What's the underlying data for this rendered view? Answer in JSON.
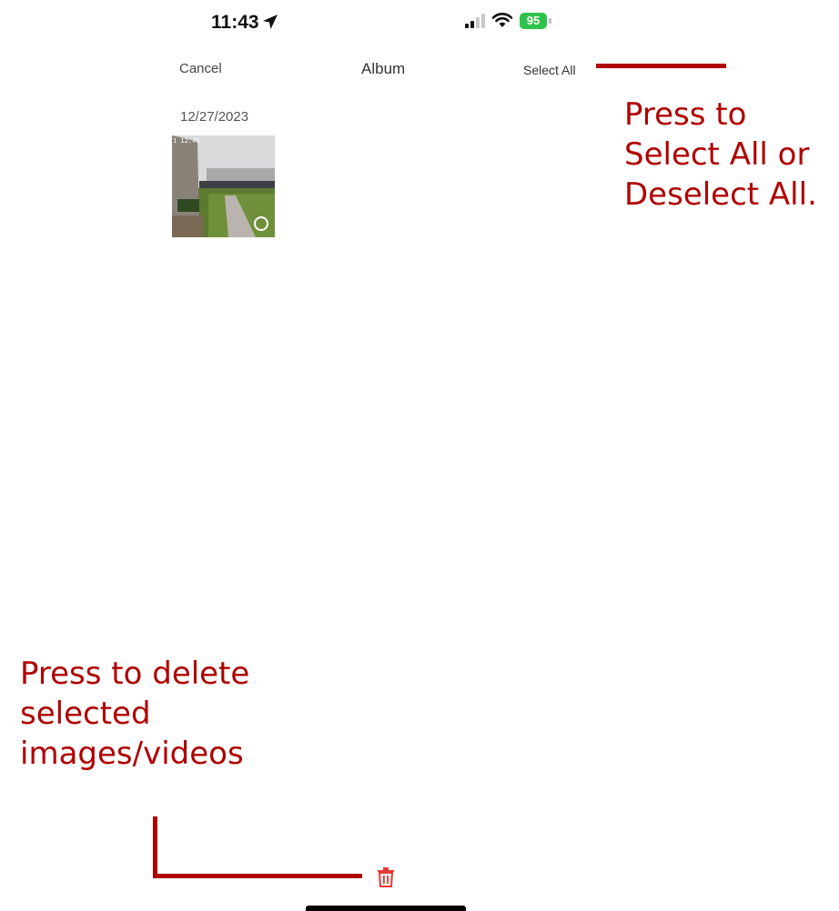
{
  "status_bar": {
    "time": "11:43",
    "battery": "95"
  },
  "nav": {
    "cancel_label": "Cancel",
    "title": "Album",
    "select_all_label": "Select All"
  },
  "album": {
    "date_header": "12/27/2023",
    "thumbnail_stamp": "1 12:46"
  },
  "annotations": {
    "select_all_lines": [
      "Press to",
      "Select All or",
      "Deselect All."
    ],
    "delete_lines": [
      "Press to delete",
      "selected",
      "images/videos"
    ]
  },
  "colors": {
    "annotation": "#b00000",
    "battery": "#2fc34b",
    "trash": "#e53935"
  },
  "icons": {
    "location": "location-arrow-icon",
    "signal": "cellular-signal-icon",
    "wifi": "wifi-icon",
    "trash": "trash-icon"
  }
}
